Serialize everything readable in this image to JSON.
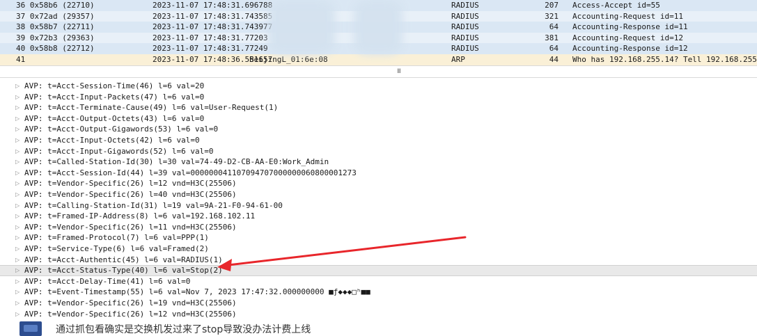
{
  "packets": [
    {
      "no": "36 0x58b6 (22710)",
      "time": "2023-11-07 17:48:31.696788",
      "source": "",
      "protocol": "RADIUS",
      "length": "207",
      "info": "Access-Accept id=55",
      "bg": "#dae7f4"
    },
    {
      "no": "37 0x72ad (29357)",
      "time": "2023-11-07 17:48:31.743585",
      "source": "",
      "protocol": "RADIUS",
      "length": "321",
      "info": "Accounting-Request id=11",
      "bg": "#e8f0f8"
    },
    {
      "no": "38 0x58b7 (22711)",
      "time": "2023-11-07 17:48:31.743977",
      "source": "",
      "protocol": "RADIUS",
      "length": "64",
      "info": "Accounting-Response id=11",
      "bg": "#dae7f4"
    },
    {
      "no": "39 0x72b3 (29363)",
      "time": "2023-11-07 17:48:31.77203",
      "source": "",
      "protocol": "RADIUS",
      "length": "381",
      "info": "Accounting-Request id=12",
      "bg": "#e8f0f8"
    },
    {
      "no": "40 0x58b8 (22712)",
      "time": "2023-11-07 17:48:31.77249",
      "source": "",
      "protocol": "RADIUS",
      "length": "64",
      "info": "Accounting-Response id=12",
      "bg": "#dae7f4"
    },
    {
      "no": "41",
      "time": "2023-11-07 17:48:36.551657",
      "source": "BeijingL_01:6e:08",
      "protocol": "ARP",
      "length": "44",
      "info": "Who has 192.168.255.14? Tell 192.168.255.254",
      "bg": "#faf0d7"
    }
  ],
  "pane_grip": "III",
  "detail_rows": [
    "AVP: t=Acct-Session-Time(46) l=6 val=20",
    "AVP: t=Acct-Input-Packets(47) l=6 val=0",
    "AVP: t=Acct-Terminate-Cause(49) l=6 val=User-Request(1)",
    "AVP: t=Acct-Output-Octets(43) l=6 val=0",
    "AVP: t=Acct-Output-Gigawords(53) l=6 val=0",
    "AVP: t=Acct-Input-Octets(42) l=6 val=0",
    "AVP: t=Acct-Input-Gigawords(52) l=6 val=0",
    "AVP: t=Called-Station-Id(30) l=30 val=74-49-D2-CB-AA-E0:Work_Admin",
    "AVP: t=Acct-Session-Id(44) l=39 val=000000041107094707000000060800001273",
    "AVP: t=Vendor-Specific(26) l=12 vnd=H3C(25506)",
    "AVP: t=Vendor-Specific(26) l=40 vnd=H3C(25506)",
    "AVP: t=Calling-Station-Id(31) l=19 val=9A-21-F0-94-61-00",
    "AVP: t=Framed-IP-Address(8) l=6 val=192.168.102.11",
    "AVP: t=Vendor-Specific(26) l=11 vnd=H3C(25506)",
    "AVP: t=Framed-Protocol(7) l=6 val=PPP(1)",
    "AVP: t=Service-Type(6) l=6 val=Framed(2)",
    "AVP: t=Acct-Authentic(45) l=6 val=RADIUS(1)",
    "AVP: t=Acct-Status-Type(40) l=6 val=Stop(2)",
    "AVP: t=Acct-Delay-Time(41) l=6 val=0",
    "AVP: t=Event-Timestamp(55) l=6 val=Nov  7, 2023 17:47:32.000000000 ■ƒ◆◆◆□ʰ■■",
    "AVP: t=Vendor-Specific(26) l=19 vnd=H3C(25506)",
    "AVP: t=Vendor-Specific(26) l=12 vnd=H3C(25506)"
  ],
  "selected_index": 17,
  "annotation_color": "#e8262b",
  "caption": "通过抓包看确实是交换机发过来了stop导致没办法计费上线"
}
